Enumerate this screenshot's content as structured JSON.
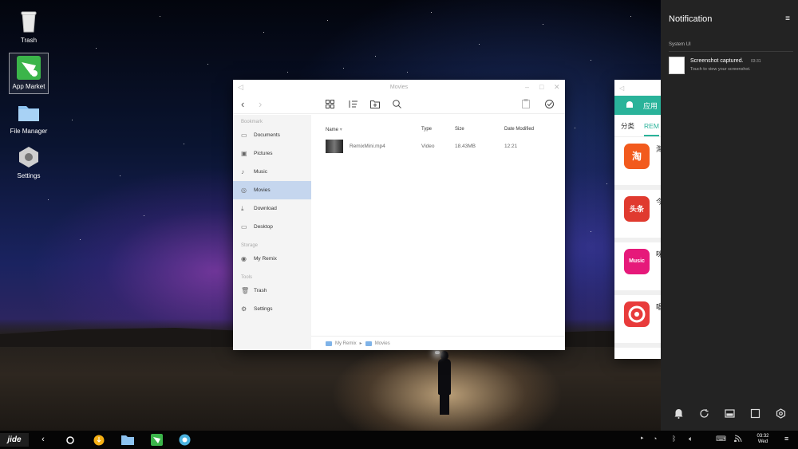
{
  "desktop": {
    "icons": [
      {
        "label": "Trash",
        "icon": "trash-icon"
      },
      {
        "label": "App Market",
        "icon": "app-market-icon",
        "selected": true
      },
      {
        "label": "File Manager",
        "icon": "folder-icon"
      },
      {
        "label": "Settings",
        "icon": "settings-hex-icon"
      }
    ]
  },
  "file_manager": {
    "title": "Movies",
    "sidebar": {
      "bookmark_header": "Bookmark",
      "bookmarks": [
        "Documents",
        "Pictures",
        "Music",
        "Movies",
        "Download",
        "Desktop"
      ],
      "storage_header": "Storage",
      "storage": [
        "My Remix"
      ],
      "tools_header": "Tools",
      "tools": [
        "Trash",
        "Settings"
      ],
      "active": "Movies"
    },
    "columns": {
      "name": "Name",
      "type": "Type",
      "size": "Size",
      "date": "Date Modified"
    },
    "files": [
      {
        "name": "RemixMini.mp4",
        "type": "Video",
        "size": "18.43MB",
        "date": "12:21"
      }
    ],
    "breadcrumb": [
      "My Remix",
      "Movies"
    ]
  },
  "app_market": {
    "header": "应用",
    "tabs": [
      "分类",
      "REM"
    ],
    "active_tab": "REM",
    "apps": [
      {
        "icon_text": "淘",
        "name": "淘",
        "color": "#f25a1d"
      },
      {
        "icon_text": "头条",
        "name": "今",
        "color": "#e03a2f"
      },
      {
        "icon_text": "Music",
        "name": "咪",
        "color": "#e6197a"
      },
      {
        "icon_text": "",
        "name": "唱",
        "color": "#e83b3b"
      }
    ]
  },
  "notification_panel": {
    "title": "Notification",
    "group": "System UI",
    "item": {
      "title": "Screenshot captured.",
      "time": "03:31",
      "subtitle": "Touch to view your screenshot."
    }
  },
  "taskbar": {
    "clock_time": "03:32",
    "clock_day": "Wed"
  },
  "colors": {
    "accent": "#2ab39a",
    "selection": "#c5d6ee",
    "panel": "#232323"
  }
}
